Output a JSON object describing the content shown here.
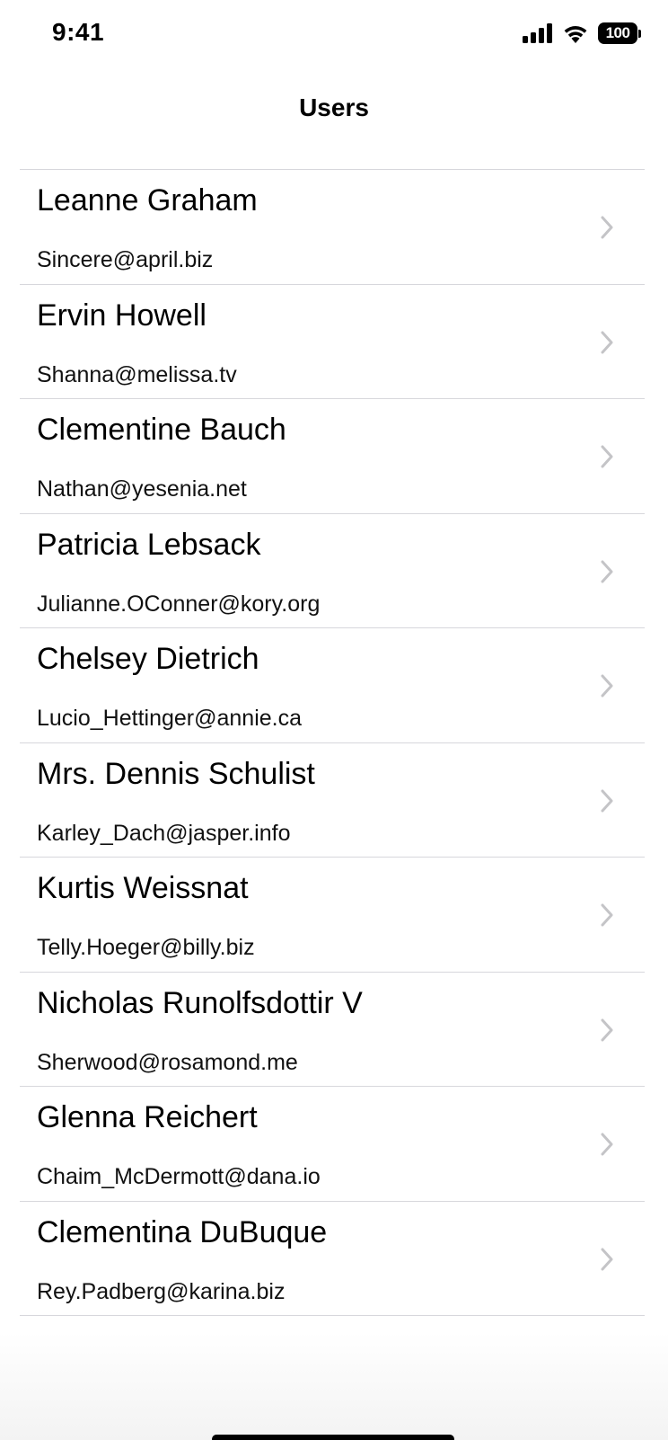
{
  "status_bar": {
    "time": "9:41",
    "battery_level": "100",
    "icons": [
      "signal-icon",
      "wifi-icon",
      "battery-icon"
    ]
  },
  "nav": {
    "title": "Users"
  },
  "users": [
    {
      "name": "Leanne Graham",
      "email": "Sincere@april.biz"
    },
    {
      "name": "Ervin Howell",
      "email": "Shanna@melissa.tv"
    },
    {
      "name": "Clementine Bauch",
      "email": "Nathan@yesenia.net"
    },
    {
      "name": "Patricia Lebsack",
      "email": "Julianne.OConner@kory.org"
    },
    {
      "name": "Chelsey Dietrich",
      "email": "Lucio_Hettinger@annie.ca"
    },
    {
      "name": "Mrs. Dennis Schulist",
      "email": "Karley_Dach@jasper.info"
    },
    {
      "name": "Kurtis Weissnat",
      "email": "Telly.Hoeger@billy.biz"
    },
    {
      "name": "Nicholas Runolfsdottir V",
      "email": "Sherwood@rosamond.me"
    },
    {
      "name": "Glenna Reichert",
      "email": "Chaim_McDermott@dana.io"
    },
    {
      "name": "Clementina DuBuque",
      "email": "Rey.Padberg@karina.biz"
    }
  ],
  "colors": {
    "separator": "#d7d7dc",
    "chevron": "#c4c4c7",
    "text": "#000000",
    "background": "#ffffff"
  }
}
